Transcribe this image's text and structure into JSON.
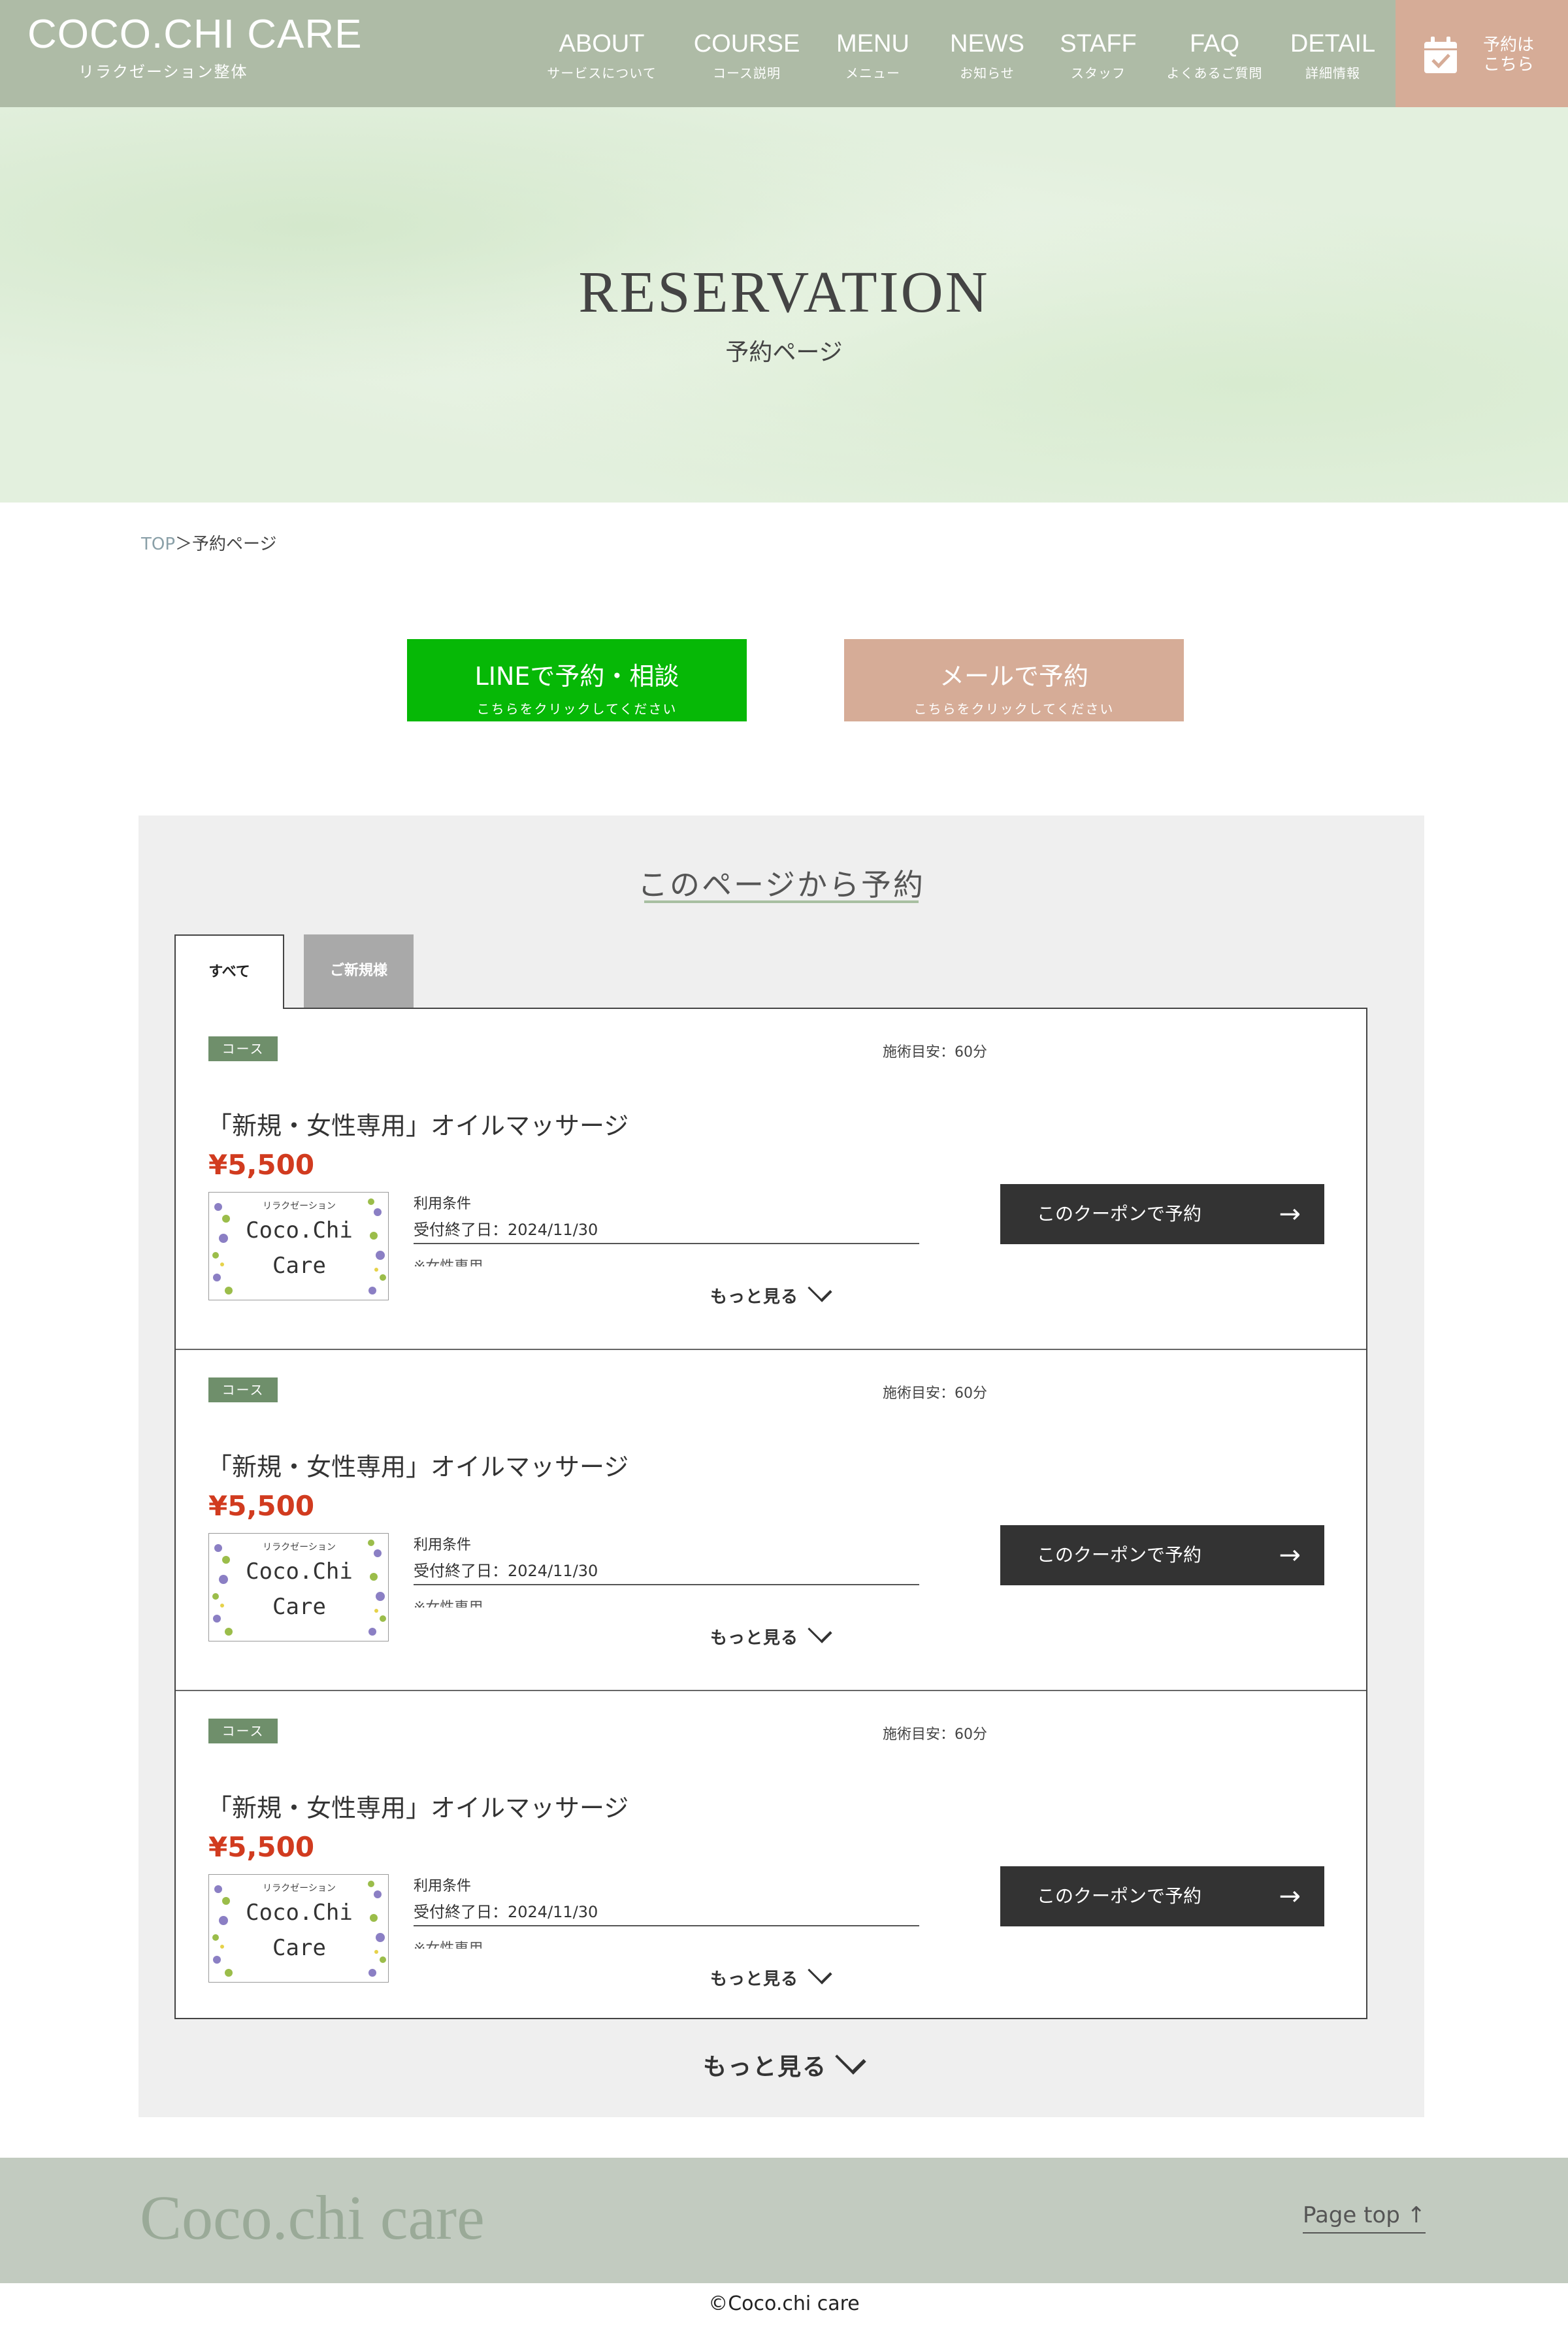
{
  "header": {
    "logo": "COCO.CHI CARE",
    "logo_sub": "リラクゼーション整体",
    "nav": [
      {
        "en": "ABOUT",
        "jp": "サービスについて"
      },
      {
        "en": "COURSE",
        "jp": "コース説明"
      },
      {
        "en": "MENU",
        "jp": "メニュー"
      },
      {
        "en": "NEWS",
        "jp": "お知らせ"
      },
      {
        "en": "STAFF",
        "jp": "スタッフ"
      },
      {
        "en": "FAQ",
        "jp": "よくあるご質問"
      },
      {
        "en": "DETAIL",
        "jp": "詳細情報"
      }
    ],
    "reserve_line1": "予約は",
    "reserve_line2": "こちら",
    "reserve_icon": "calendar-check-icon"
  },
  "hero": {
    "title": "RESERVATION",
    "subtitle": "予約ページ"
  },
  "breadcrumb": {
    "home": "TOP",
    "separator": "＞",
    "current": "予約ページ"
  },
  "buttons": {
    "line_main": "LINEで予約・相談",
    "line_sub": "こちらをクリックしてください",
    "mail_main": "メールで予約",
    "mail_sub": "こちらをクリックしてください"
  },
  "reserve_section": {
    "title": "このページから予約",
    "tabs": [
      "すべて",
      "ご新規様"
    ],
    "cards": [
      {
        "badge": "コース",
        "duration": "施術目安：60分",
        "title": "「新規・女性専用」オイルマッサージ",
        "price": "¥5,500",
        "thumb_small": "リラクゼーション",
        "thumb_line1": "Coco.Chi",
        "thumb_line2": "Care",
        "cond_label": "利用条件",
        "cond_date": "受付終了日：2024/11/30",
        "cond_note": "※女性専用",
        "more": "もっと見る",
        "coupon": "このクーポンで予約",
        "arrow": "→"
      },
      {
        "badge": "コース",
        "duration": "施術目安：60分",
        "title": "「新規・女性専用」オイルマッサージ",
        "price": "¥5,500",
        "thumb_small": "リラクゼーション",
        "thumb_line1": "Coco.Chi",
        "thumb_line2": "Care",
        "cond_label": "利用条件",
        "cond_date": "受付終了日：2024/11/30",
        "cond_note": "※女性専用",
        "more": "もっと見る",
        "coupon": "このクーポンで予約",
        "arrow": "→"
      },
      {
        "badge": "コース",
        "duration": "施術目安：60分",
        "title": "「新規・女性専用」オイルマッサージ",
        "price": "¥5,500",
        "thumb_small": "リラクゼーション",
        "thumb_line1": "Coco.Chi",
        "thumb_line2": "Care",
        "cond_label": "利用条件",
        "cond_date": "受付終了日：2024/11/30",
        "cond_note": "※女性専用",
        "more": "もっと見る",
        "coupon": "このクーポンで予約",
        "arrow": "→"
      }
    ],
    "more_all": "もっと見る"
  },
  "footer": {
    "logo": "Coco.chi care",
    "pagetop": "Page top ↑",
    "copyright": "©Coco.chi care"
  },
  "colors": {
    "header_bg": "#aebba6",
    "accent_peach": "#d6ac97",
    "line_green": "#06b806",
    "price_red": "#d13b1f",
    "badge_green": "#6f8f6b",
    "dark_button": "#333333"
  }
}
